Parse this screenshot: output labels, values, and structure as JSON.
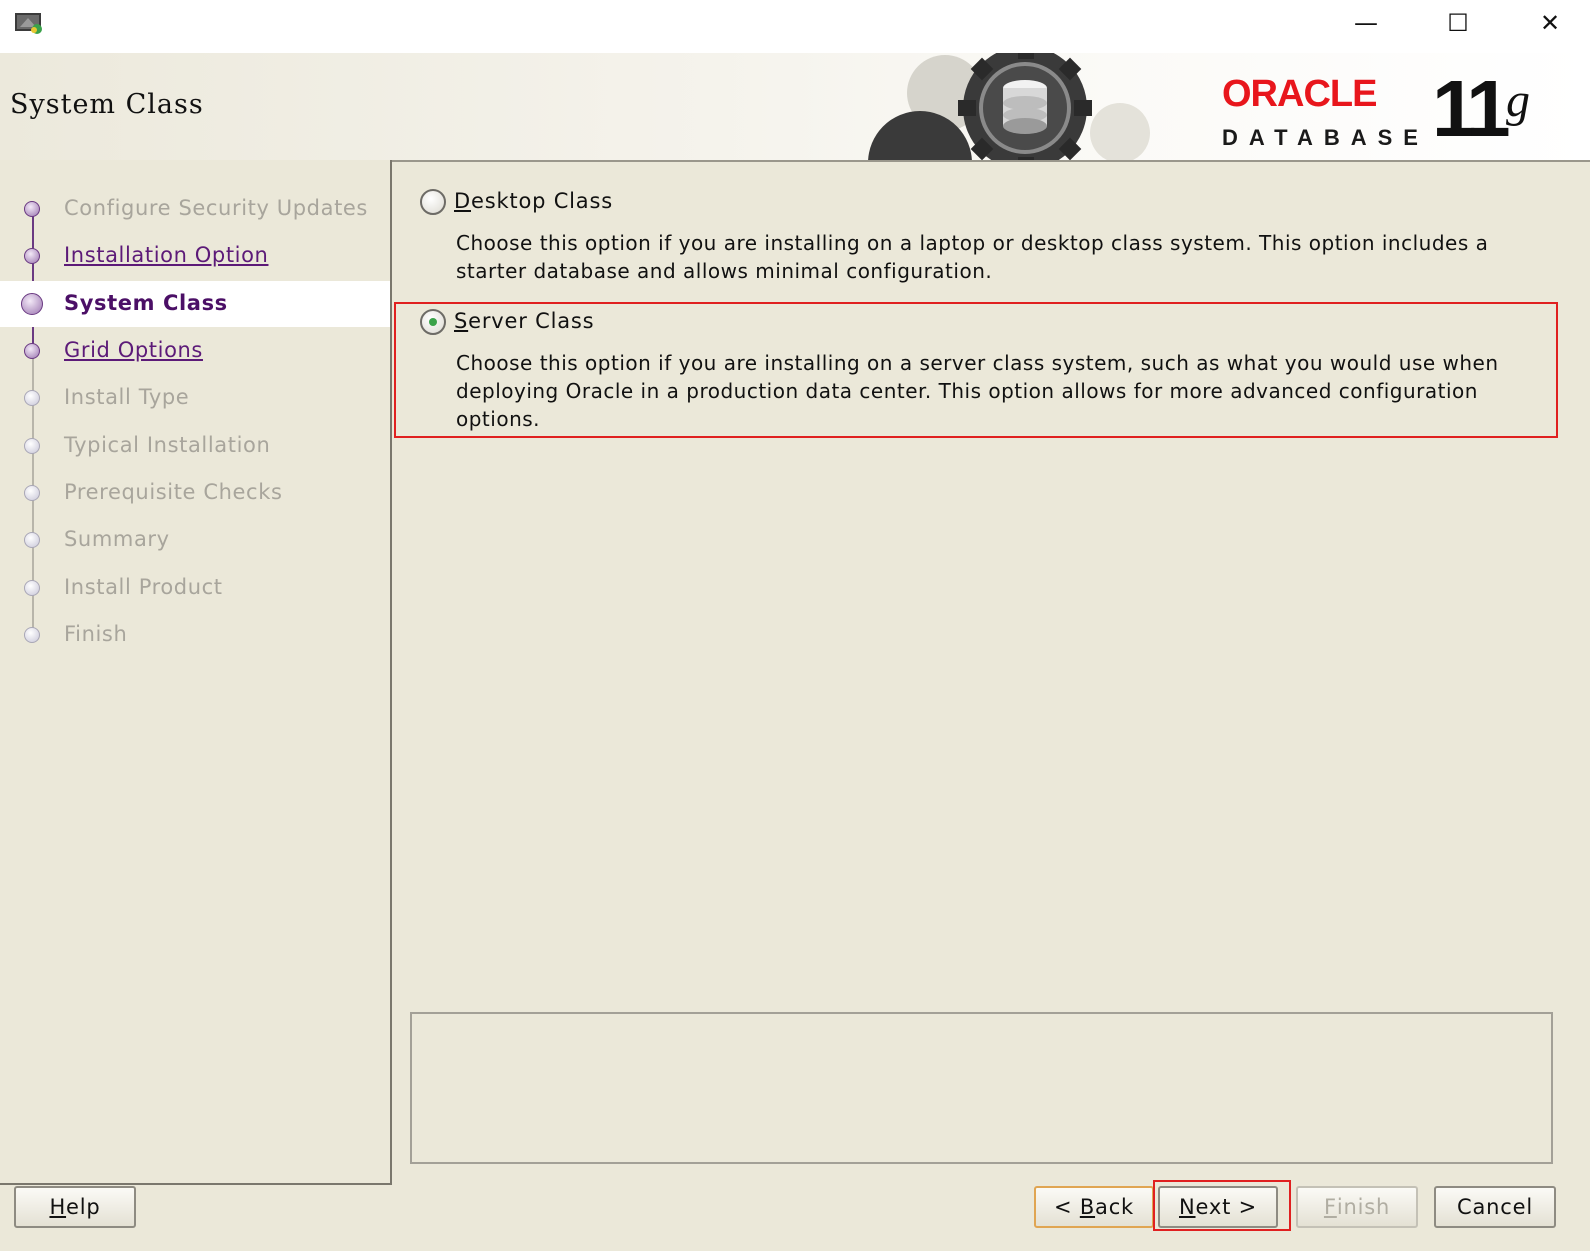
{
  "window": {
    "minimize_glyph": "—",
    "maximize_glyph": "☐",
    "close_glyph": "✕"
  },
  "header": {
    "page_title": "System Class",
    "brand_oracle": "ORACLE",
    "brand_database": "DATABASE",
    "brand_version": "11",
    "brand_version_sup": "g"
  },
  "sidebar": {
    "steps": [
      {
        "label": "Configure Security Updates",
        "state": "done-disabled"
      },
      {
        "label": "Installation Option",
        "state": "link"
      },
      {
        "label": "System Class",
        "state": "current"
      },
      {
        "label": "Grid Options",
        "state": "link"
      },
      {
        "label": "Install Type",
        "state": "pending"
      },
      {
        "label": "Typical Installation",
        "state": "pending"
      },
      {
        "label": "Prerequisite Checks",
        "state": "pending"
      },
      {
        "label": "Summary",
        "state": "pending"
      },
      {
        "label": "Install Product",
        "state": "pending"
      },
      {
        "label": "Finish",
        "state": "pending"
      }
    ]
  },
  "options": {
    "desktop": {
      "title_first": "D",
      "title_rest": "esktop Class",
      "description": "Choose this option if you are installing on a laptop or desktop class system. This option includes a starter database and allows minimal configuration.",
      "selected": false
    },
    "server": {
      "title_first": "S",
      "title_rest": "erver Class",
      "description": "Choose this option if you are installing on a server class system, such as what you would use when deploying Oracle in a production data center. This option allows for more advanced configuration options.",
      "selected": true
    }
  },
  "buttons": {
    "help_first": "H",
    "help_rest": "elp",
    "back_prefix": "< ",
    "back_first": "B",
    "back_rest": "ack",
    "next_first": "N",
    "next_rest": "ext >",
    "finish_first": "F",
    "finish_rest": "inish",
    "cancel": "Cancel"
  },
  "colors": {
    "accent_purple": "#5c1a78",
    "highlight_red": "#e02020",
    "oracle_red": "#e8161c",
    "background": "#ebe8d9"
  }
}
